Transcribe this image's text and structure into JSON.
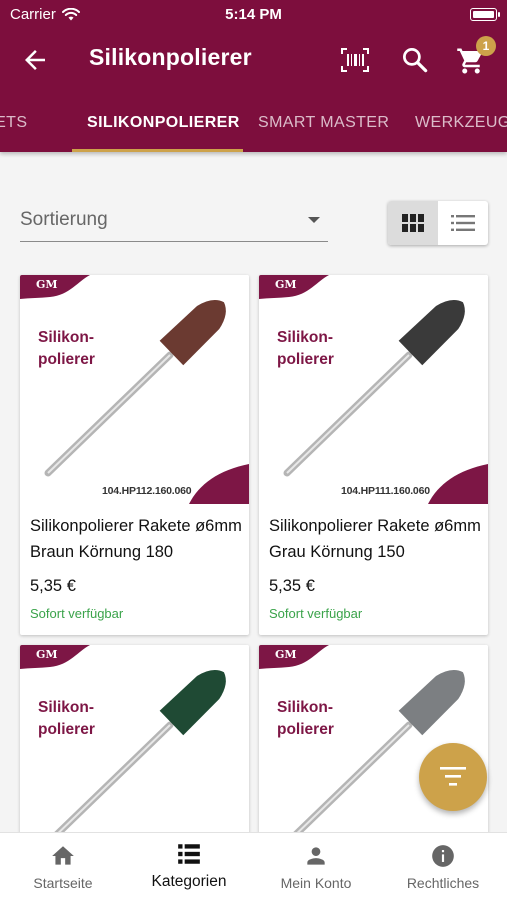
{
  "status_bar": {
    "carrier": "Carrier",
    "time": "5:14 PM"
  },
  "toolbar": {
    "title": "Silikonpolierer",
    "cart_count": "1"
  },
  "tabs": [
    "SETS",
    "SILIKONPOLIERER",
    "SMART MASTER",
    "WERKZEUG"
  ],
  "sort": {
    "label": "Sortierung"
  },
  "brand": {
    "logo_text": "GM"
  },
  "colors": {
    "primary": "#7d0e3d",
    "accent": "#cda24a",
    "available": "#3aa34a"
  },
  "products": [
    {
      "image_text": "Silikon-\npolierer",
      "sku": "104.HP112.160.060",
      "title": "Silikonpolierer Rakete ø6mm Braun Körnung 180",
      "price": "5,35 €",
      "availability": "Sofort verfügbar",
      "color": "#6b3a31"
    },
    {
      "image_text": "Silikon-\npolierer",
      "sku": "104.HP111.160.060",
      "title": "Silikonpolierer Rakete ø6mm Grau Körnung 150",
      "price": "5,35 €",
      "availability": "Sofort verfügbar",
      "color": "#3a3a3a"
    },
    {
      "image_text": "Silikon-\npolierer",
      "color": "#1f4a34"
    },
    {
      "image_text": "Silikon-\npolierer",
      "color": "#7c7f82"
    }
  ],
  "bottom_nav": [
    {
      "label": "Startseite",
      "icon": "home-icon"
    },
    {
      "label": "Kategorien",
      "icon": "list-icon"
    },
    {
      "label": "Mein Konto",
      "icon": "person-icon"
    },
    {
      "label": "Rechtliches",
      "icon": "info-icon"
    }
  ]
}
